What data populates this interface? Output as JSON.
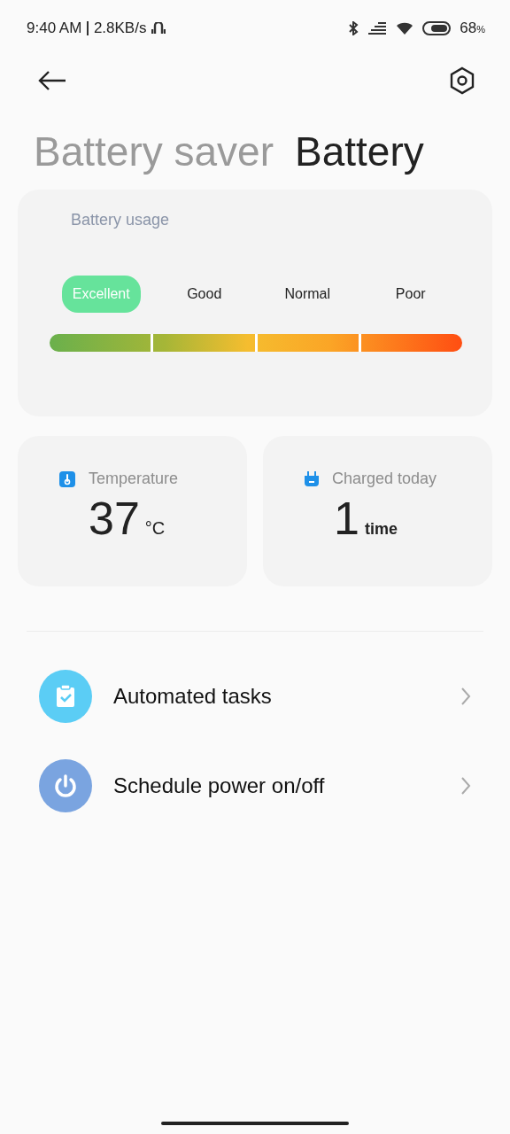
{
  "status_bar": {
    "time": "9:40 AM",
    "speed": "2.8KB/s",
    "battery": "68",
    "battery_unit": "%"
  },
  "tabs": [
    {
      "label": "Battery saver",
      "selected": false
    },
    {
      "label": "Battery",
      "selected": true
    }
  ],
  "usage": {
    "title": "Battery usage",
    "levels": [
      {
        "label": "Excellent",
        "selected": true
      },
      {
        "label": "Good",
        "selected": false
      },
      {
        "label": "Normal",
        "selected": false
      },
      {
        "label": "Poor",
        "selected": false
      }
    ]
  },
  "stats": [
    {
      "kind": "temperature",
      "label": "Temperature",
      "value": "37",
      "unit": "°C"
    },
    {
      "kind": "charge",
      "label": "Charged today",
      "value": "1",
      "unit": "time"
    }
  ],
  "items": [
    {
      "kind": "tasks",
      "label": "Automated tasks",
      "color": "#5bcdf5"
    },
    {
      "kind": "power",
      "label": "Schedule power on/off",
      "color": "#7aa4e0"
    }
  ]
}
